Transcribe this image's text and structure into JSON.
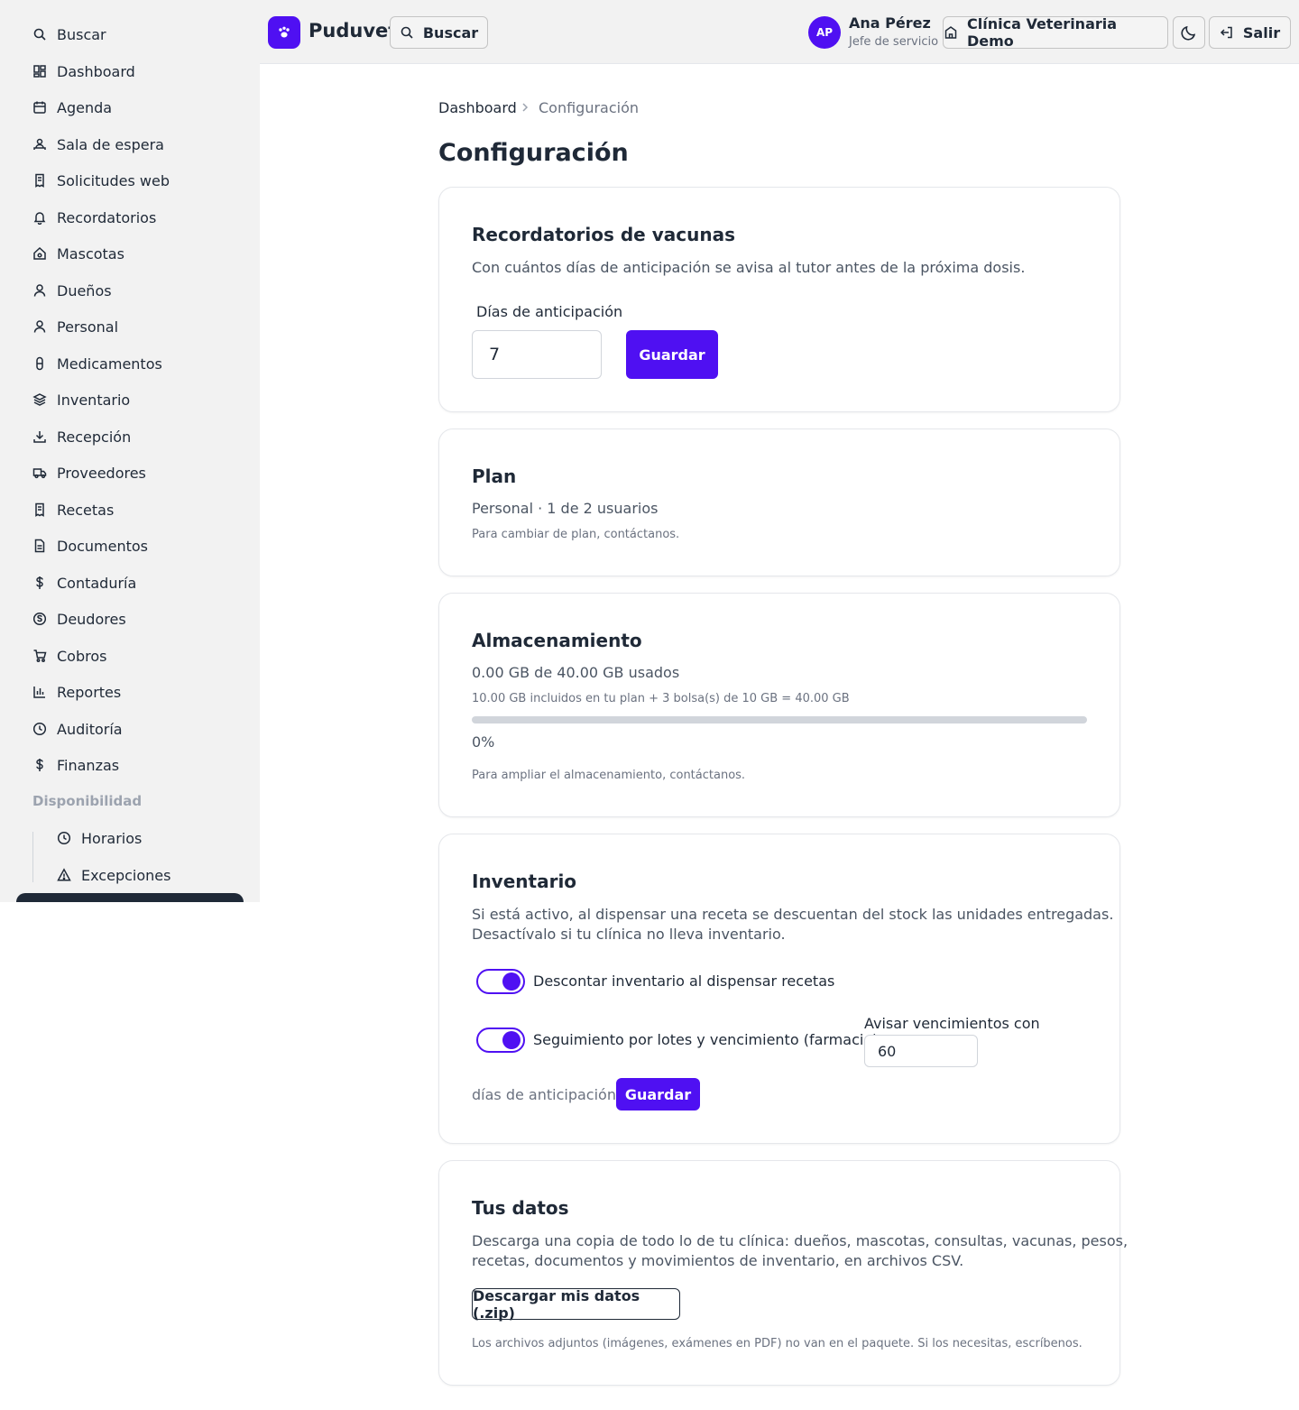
{
  "sidebar": {
    "items": [
      {
        "label": "Buscar",
        "icon": "search-icon"
      },
      {
        "label": "Dashboard",
        "icon": "dashboard-icon"
      },
      {
        "label": "Agenda",
        "icon": "calendar-icon"
      },
      {
        "label": "Sala de espera",
        "icon": "waiting-room-icon"
      },
      {
        "label": "Solicitudes web",
        "icon": "receipt-icon"
      },
      {
        "label": "Recordatorios",
        "icon": "bell-icon"
      },
      {
        "label": "Mascotas",
        "icon": "paw-house-icon"
      },
      {
        "label": "Dueños",
        "icon": "user-icon"
      },
      {
        "label": "Personal",
        "icon": "user-icon"
      },
      {
        "label": "Medicamentos",
        "icon": "pill-icon"
      },
      {
        "label": "Inventario",
        "icon": "layers-icon"
      },
      {
        "label": "Recepción",
        "icon": "download-icon"
      },
      {
        "label": "Proveedores",
        "icon": "truck-icon"
      },
      {
        "label": "Recetas",
        "icon": "receipt-icon"
      },
      {
        "label": "Documentos",
        "icon": "document-icon"
      },
      {
        "label": "Contaduría",
        "icon": "dollar-icon"
      },
      {
        "label": "Deudores",
        "icon": "coin-icon"
      },
      {
        "label": "Cobros",
        "icon": "cart-icon"
      },
      {
        "label": "Reportes",
        "icon": "bar-chart-icon"
      },
      {
        "label": "Auditoría",
        "icon": "clock-icon"
      },
      {
        "label": "Finanzas",
        "icon": "dollar-icon"
      }
    ],
    "section_label": "Disponibilidad",
    "sub_items": [
      {
        "label": "Horarios",
        "icon": "clock-icon"
      },
      {
        "label": "Excepciones",
        "icon": "warning-icon"
      }
    ]
  },
  "header": {
    "brand": "Puduvet",
    "search_label": "Buscar",
    "user_initials": "AP",
    "user_name": "Ana Pérez",
    "user_role": "Jefe de servicio",
    "clinic_label": "Clínica Veterinaria Demo",
    "logout_label": "Salir"
  },
  "breadcrumb": {
    "home": "Dashboard",
    "current": "Configuración"
  },
  "page_title": "Configuración",
  "vaccines": {
    "title": "Recordatorios de vacunas",
    "description": "Con cuántos días de anticipación se avisa al tutor antes de la próxima dosis.",
    "field_label": "Días de anticipación",
    "field_value": "7",
    "save_label": "Guardar"
  },
  "plan": {
    "title": "Plan",
    "summary": "Personal · 1 de 2 usuarios",
    "note": "Para cambiar de plan, contáctanos."
  },
  "storage": {
    "title": "Almacenamiento",
    "usage": "0.00 GB de 40.00 GB usados",
    "detail": "10.00 GB incluidos en tu plan + 3 bolsa(s) de 10 GB = 40.00 GB",
    "percent_label": "0%",
    "percent": 0,
    "note": "Para ampliar el almacenamiento, contáctanos."
  },
  "inventory": {
    "title": "Inventario",
    "description_line1": "Si está activo, al dispensar una receta se descuentan del stock las unidades entregadas.",
    "description_line2": "Desactívalo si tu clínica no lleva inventario.",
    "toggle1_label": "Descontar inventario al dispensar recetas",
    "toggle1_on": true,
    "toggle2_label": "Seguimiento por lotes y vencimiento (farmacia)",
    "toggle2_on": true,
    "expiry_label": "Avisar vencimientos con",
    "expiry_value": "60",
    "expiry_suffix": "días de anticipación",
    "save_label": "Guardar"
  },
  "data_export": {
    "title": "Tus datos",
    "description_line1": "Descarga una copia de todo lo de tu clínica: dueños, mascotas, consultas, vacunas, pesos,",
    "description_line2": "recetas, documentos y movimientos de inventario, en archivos CSV.",
    "download_label": "Descargar mis datos (.zip)",
    "note": "Los archivos adjuntos (imágenes, exámenes en PDF) no van en el paquete. Si los necesitas, escríbenos."
  },
  "colors": {
    "accent": "#4f10f2",
    "sidebar_bg": "#f2f2f2",
    "text": "#1f2937",
    "muted": "#6b7280"
  }
}
